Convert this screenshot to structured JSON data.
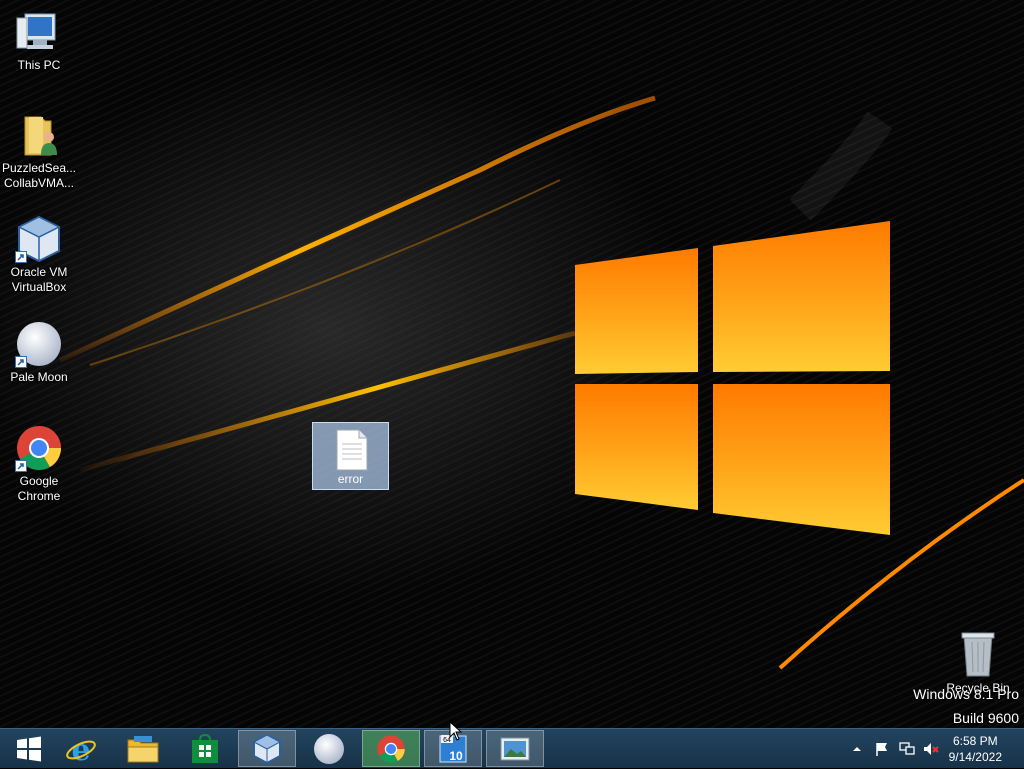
{
  "desktop_icons": [
    {
      "label": "This PC",
      "icon": "this-pc-icon"
    },
    {
      "label": "PuzzledSea...\nCollabVMA...",
      "icon": "user-folder-icon"
    },
    {
      "label": "Oracle VM VirtualBox",
      "icon": "virtualbox-icon"
    },
    {
      "label": "Pale Moon",
      "icon": "pale-moon-icon"
    },
    {
      "label": "Google Chrome",
      "icon": "chrome-icon"
    }
  ],
  "desktop_file": {
    "label": "error",
    "icon": "text-file-icon",
    "selected": true
  },
  "recycle_bin": {
    "label": "Recycle Bin",
    "icon": "recycle-bin-icon"
  },
  "watermark": {
    "line1": "Windows 8.1 Pro",
    "line2": "Build 9600"
  },
  "taskbar": {
    "items": [
      {
        "name": "start",
        "icon": "windows-logo-icon"
      },
      {
        "name": "internet-explorer",
        "icon": "ie-icon"
      },
      {
        "name": "file-explorer",
        "icon": "folder-icon"
      },
      {
        "name": "store",
        "icon": "store-icon"
      },
      {
        "name": "virtualbox",
        "icon": "virtualbox-icon",
        "active": true
      },
      {
        "name": "pale-moon",
        "icon": "pale-moon-icon"
      },
      {
        "name": "chrome",
        "icon": "chrome-icon",
        "active": true
      },
      {
        "name": "win10-installer",
        "icon": "setup-icon",
        "active": true
      },
      {
        "name": "photos",
        "icon": "photo-icon",
        "active": true
      }
    ],
    "installer_badge": "64",
    "installer_number": "10"
  },
  "tray": {
    "icons": [
      "show-hidden-arrow-icon",
      "action-center-flag-icon",
      "network-icon",
      "volume-muted-icon"
    ]
  },
  "clock": {
    "time": "6:58 PM",
    "date": "9/14/2022"
  },
  "colors": {
    "taskbar": "#1b3a52",
    "accent_orange": "#ff8a00",
    "selection": "#a8c4e4"
  }
}
